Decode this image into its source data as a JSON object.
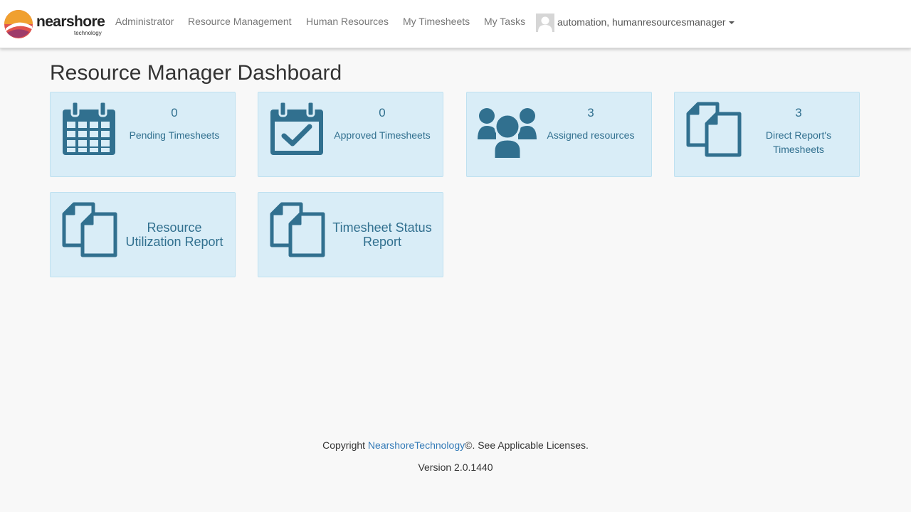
{
  "brand": {
    "name": "nearshore",
    "tagline": "technology",
    "colors": [
      "#f0a030",
      "#e0524d",
      "#9e3b6a"
    ]
  },
  "nav": {
    "items": [
      {
        "label": "Administrator"
      },
      {
        "label": "Resource Management"
      },
      {
        "label": "Human Resources"
      },
      {
        "label": "My Timesheets"
      },
      {
        "label": "My Tasks"
      }
    ],
    "user": {
      "name": "automation, humanresourcesmanager",
      "avatar_icon": "user-silhouette-icon"
    }
  },
  "page": {
    "title": "Resource Manager Dashboard"
  },
  "tiles": [
    {
      "count": "0",
      "label": "Pending Timesheets",
      "icon": "calendar-icon"
    },
    {
      "count": "0",
      "label": "Approved Timesheets",
      "icon": "calendar-check-icon"
    },
    {
      "count": "3",
      "label": "Assigned resources",
      "icon": "users-icon"
    },
    {
      "count": "3",
      "label": "Direct Report's Timesheets",
      "icon": "documents-icon"
    },
    {
      "label": "Resource Utilization Report",
      "icon": "documents-icon"
    },
    {
      "label": "Timesheet Status Report",
      "icon": "documents-icon"
    }
  ],
  "footer": {
    "copyright_prefix": "Copyright ",
    "company_link": "NearshoreTechnology",
    "copyright_suffix": "©. See Applicable Licenses.",
    "version": "Version 2.0.1440"
  },
  "colors": {
    "tile_bg": "#d9edf7",
    "tile_text": "#31708f",
    "icon": "#31708f",
    "link": "#337ab7"
  }
}
